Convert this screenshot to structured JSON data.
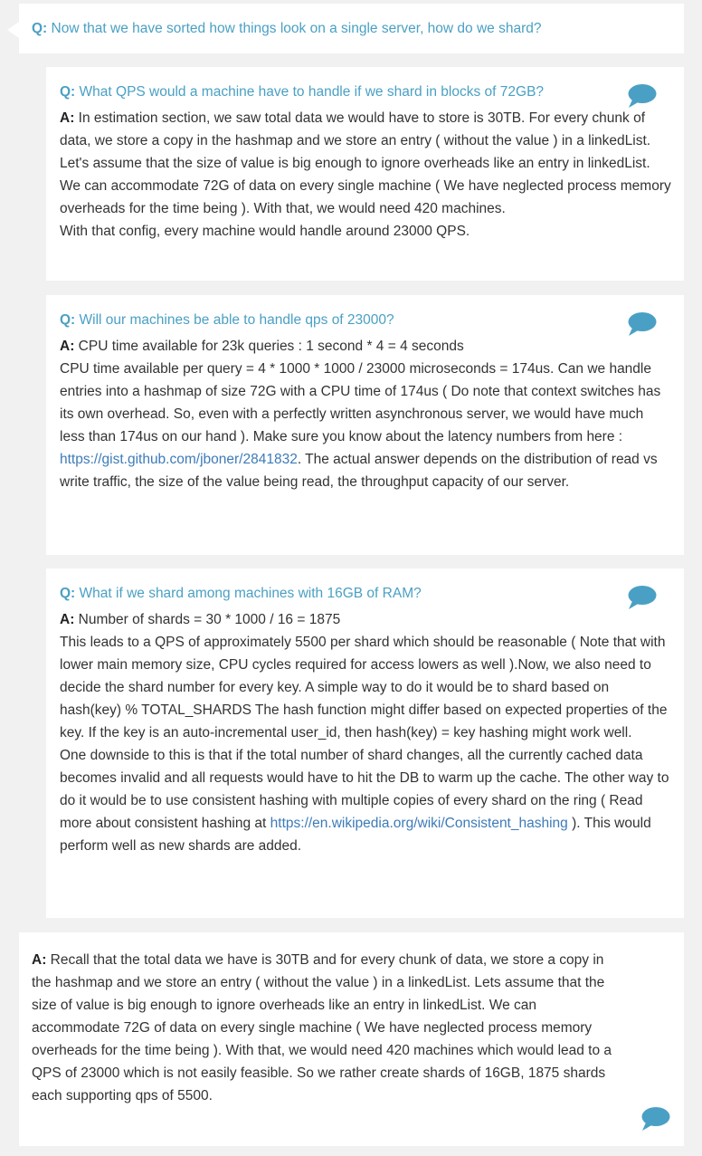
{
  "top_question": {
    "prefix": "Q:",
    "text": "Now that we have sorted how things look on a single server, how do we shard?"
  },
  "hints": [
    {
      "q_prefix": "Q:",
      "question": "What QPS would a machine have to handle if we shard in blocks of 72GB?",
      "a_prefix": "A:",
      "lines": [
        "In estimation section, we saw total data we would have to store is 30TB. For every chunk of data, we store a copy in the hashmap and we store an entry ( without the value ) in a linkedList. Let's assume that the size of value is big enough to ignore overheads like an entry in linkedList. We can accommodate 72G of data on every single machine ( We have neglected process memory overheads for the time being ). With that, we would need 420 machines.",
        "With that config, every machine would handle around 23000 QPS."
      ]
    },
    {
      "q_prefix": "Q:",
      "question": "Will our machines be able to handle qps of 23000?",
      "a_prefix": "A:",
      "line1": "CPU time available for 23k queries : 1 second * 4 = 4 seconds",
      "line2_before_link": "CPU time available per query = 4 * 1000 * 1000 / 23000 microseconds = 174us. Can we handle entries into a hashmap of size 72G with a CPU time of 174us ( Do note that context switches has its own overhead. So, even with a perfectly written asynchronous server, we would have much less than 174us on our hand ). Make sure you know about the latency numbers from here : ",
      "link": "https://gist.github.com/jboner/2841832",
      "line2_after_link": ". The actual answer depends on the distribution of read vs write traffic, the size of the value being read, the throughput capacity of our server."
    },
    {
      "q_prefix": "Q:",
      "question": "What if we shard among machines with 16GB of RAM?",
      "a_prefix": "A:",
      "line1": "Number of shards = 30 * 1000 / 16 = 1875",
      "line2": "This leads to a QPS of approximately 5500 per shard which should be reasonable ( Note that with lower main memory size, CPU cycles required for access lowers as well ).Now, we also need to decide the shard number for every key. A simple way to do it would be to shard based on hash(key) % TOTAL_SHARDS The hash function might differ based on expected properties of the key. If the key is an auto-incremental user_id, then hash(key) = key hashing might work well.",
      "line3_before_link": "One downside to this is that if the total number of shard changes, all the currently cached data becomes invalid and all requests would have to hit the DB to warm up the cache. The other way to do it would be to use consistent hashing with multiple copies of every shard on the ring ( Read more about consistent hashing at ",
      "link": "https://en.wikipedia.org/wiki/Consistent_hashing",
      "line3_after_link": " ). This would perform well as new shards are added."
    }
  ],
  "final_answer": {
    "a_prefix": "A:",
    "text": "Recall that the total data we have is 30TB and for every chunk of data, we store a copy in the hashmap and we store an entry ( without the value ) in a linkedList. Lets assume that the size of value is big enough to ignore overheads like an entry in linkedList. We can accommodate 72G of data on every single machine ( We have neglected process memory overheads for the time being ). With that, we would need 420 machines which would lead to a QPS of 23000 which is not easily feasible. So we rather create shards of 16GB, 1875 shards each supporting qps of 5500."
  },
  "colors": {
    "question": "#4aa0c4",
    "link": "#3d7bb8",
    "bubble": "#4aa0c4",
    "background": "#f1f1f1"
  },
  "icons": {
    "comment": "speech-bubble-icon"
  }
}
